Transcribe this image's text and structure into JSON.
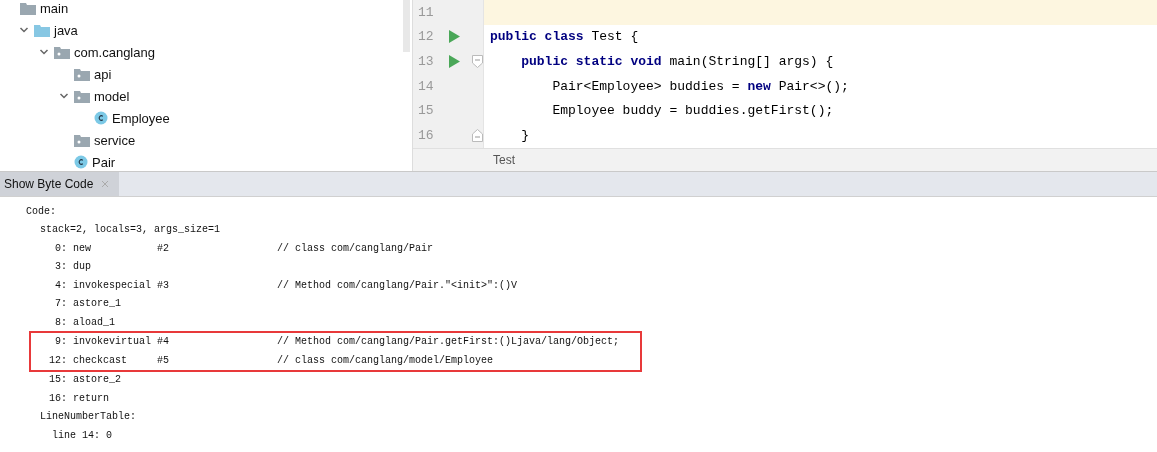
{
  "project_tree": [
    {
      "label": "main",
      "kind": "folder",
      "children": [
        {
          "label": "java",
          "kind": "source-folder",
          "expanded": true,
          "children": [
            {
              "label": "com.canglang",
              "kind": "package",
              "expanded": true,
              "children": [
                {
                  "label": "api",
                  "kind": "package"
                },
                {
                  "label": "model",
                  "kind": "package",
                  "expanded": true,
                  "children": [
                    {
                      "label": "Employee",
                      "kind": "class"
                    }
                  ]
                },
                {
                  "label": "service",
                  "kind": "package"
                },
                {
                  "label": "Pair",
                  "kind": "class"
                }
              ]
            }
          ]
        }
      ]
    }
  ],
  "editor": {
    "lines": [
      {
        "number": "11",
        "current": true,
        "run": false,
        "fold_open": false,
        "fold_close": false
      },
      {
        "number": "12",
        "current": false,
        "run": true,
        "fold_open": false,
        "fold_close": false,
        "tokens": [
          {
            "text": "public class",
            "kind": "keyword"
          },
          {
            "text": " Test {",
            "kind": "plain"
          }
        ]
      },
      {
        "number": "13",
        "current": false,
        "run": true,
        "fold_open": true,
        "fold_close": false,
        "tokens": [
          {
            "text": "    public static void",
            "kind": "keyword"
          },
          {
            "text": " main(String[] args) {",
            "kind": "plain"
          }
        ]
      },
      {
        "number": "14",
        "current": false,
        "run": false,
        "fold_open": false,
        "fold_close": false,
        "tokens": [
          {
            "text": "        Pair<Employee> buddies = ",
            "kind": "plain"
          },
          {
            "text": "new",
            "kind": "keyword"
          },
          {
            "text": " Pair<>();",
            "kind": "plain"
          }
        ]
      },
      {
        "number": "15",
        "current": false,
        "run": false,
        "fold_open": false,
        "fold_close": false,
        "tokens": [
          {
            "text": "        Employee buddy = buddies.getFirst();",
            "kind": "plain"
          }
        ]
      },
      {
        "number": "16",
        "current": false,
        "run": false,
        "fold_open": false,
        "fold_close": true,
        "tokens": [
          {
            "text": "    }",
            "kind": "plain"
          }
        ]
      }
    ],
    "breadcrumb": "Test"
  },
  "tool_window": {
    "tabs": [
      {
        "label": "Show Byte Code",
        "selected": true
      }
    ],
    "lines": [
      {
        "kind": "section",
        "text": "Code:"
      },
      {
        "kind": "sub",
        "text": "stack=2, locals=3, args_size=1"
      },
      {
        "kind": "instr",
        "offset": "0:",
        "opcode": "new",
        "operand": "#2",
        "comment": "// class com/canglang/Pair",
        "highlighted": false
      },
      {
        "kind": "instr",
        "offset": "3:",
        "opcode": "dup",
        "highlighted": false
      },
      {
        "kind": "instr",
        "offset": "4:",
        "opcode": "invokespecial",
        "operand": "#3",
        "comment": "// Method com/canglang/Pair.\"<init>\":()V",
        "highlighted": false
      },
      {
        "kind": "instr",
        "offset": "7:",
        "opcode": "astore_1",
        "highlighted": false
      },
      {
        "kind": "instr",
        "offset": "8:",
        "opcode": "aload_1",
        "highlighted": false
      },
      {
        "kind": "instr",
        "offset": "9:",
        "opcode": "invokevirtual",
        "operand": "#4",
        "comment": "// Method com/canglang/Pair.getFirst:()Ljava/lang/Object;",
        "highlighted": true
      },
      {
        "kind": "instr",
        "offset": "12:",
        "opcode": "checkcast",
        "operand": "#5",
        "comment": "// class com/canglang/model/Employee",
        "highlighted": true
      },
      {
        "kind": "instr",
        "offset": "15:",
        "opcode": "astore_2",
        "highlighted": false
      },
      {
        "kind": "instr",
        "offset": "16:",
        "opcode": "return",
        "highlighted": false
      },
      {
        "kind": "sub",
        "text": "LineNumberTable:"
      },
      {
        "kind": "entry",
        "text": "line 14: 0"
      }
    ]
  }
}
